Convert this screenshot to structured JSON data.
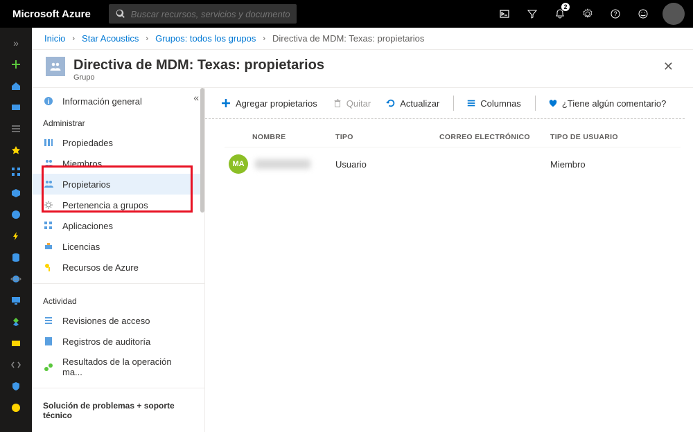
{
  "header": {
    "logo": "Microsoft Azure",
    "search_placeholder": "Buscar recursos, servicios y documentos (G+/)",
    "notification_count": "2"
  },
  "breadcrumb": {
    "items": [
      "Inicio",
      "Star Acoustics",
      "Grupos: todos los grupos"
    ],
    "current": "Directiva de MDM: Texas: propietarios"
  },
  "blade": {
    "title": "Directiva de MDM: Texas: propietarios",
    "subtitle": "Grupo"
  },
  "nav": {
    "overview": "Información general",
    "sections": [
      {
        "title": "Administrar",
        "items": [
          "Propiedades",
          "Miembros",
          "Propietarios",
          "Pertenencia a grupos",
          "Aplicaciones",
          "Licencias",
          "Recursos de Azure"
        ]
      },
      {
        "title": "Actividad",
        "items": [
          "Revisiones de acceso",
          "Registros de auditoría",
          "Resultados de la operación ma..."
        ]
      }
    ],
    "footer": "Solución de problemas + soporte técnico"
  },
  "commands": {
    "add": "Agregar propietarios",
    "remove": "Quitar",
    "refresh": "Actualizar",
    "columns": "Columnas",
    "feedback": "¿Tiene algún comentario?"
  },
  "table": {
    "headers": {
      "name": "NOMBRE",
      "type": "TIPO",
      "email": "CORREO ELECTRÓNICO",
      "usertype": "TIPO DE USUARIO"
    },
    "rows": [
      {
        "initials": "MA",
        "name_redacted": true,
        "type": "Usuario",
        "email": "",
        "usertype": "Miembro"
      }
    ]
  },
  "colors": {
    "primary": "#0078d4",
    "highlight": "#e81123",
    "avatar_green": "#8cbf26"
  }
}
